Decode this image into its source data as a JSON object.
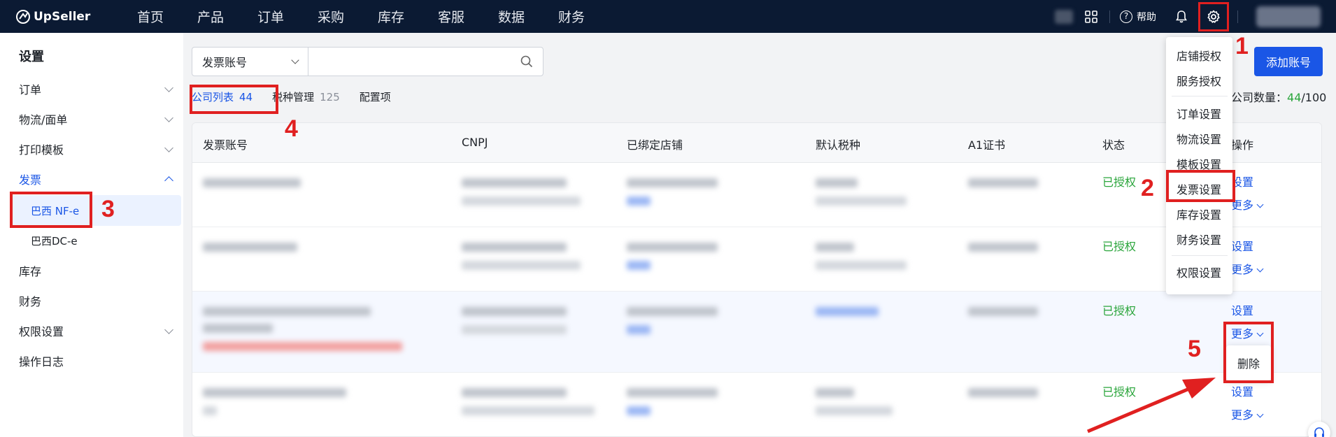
{
  "app": {
    "logo_text": "UpSeller"
  },
  "topnav": {
    "items": [
      "首页",
      "产品",
      "订单",
      "采购",
      "库存",
      "客服",
      "数据",
      "财务"
    ],
    "help_label": "帮助",
    "icons": [
      "apps-grid-icon",
      "help-icon",
      "bell-icon",
      "gear-icon"
    ]
  },
  "sidebar": {
    "title": "设置",
    "items": [
      {
        "label": "订单",
        "expandable": true
      },
      {
        "label": "物流/面单",
        "expandable": true
      },
      {
        "label": "打印模板",
        "expandable": true
      },
      {
        "label": "发票",
        "expandable": true,
        "expanded": true
      },
      {
        "label": "巴西 NF-e",
        "sub": true,
        "active": true
      },
      {
        "label": "巴西DC-e",
        "sub": true
      },
      {
        "label": "库存",
        "expandable": false
      },
      {
        "label": "财务",
        "expandable": false
      },
      {
        "label": "权限设置",
        "expandable": true
      },
      {
        "label": "操作日志",
        "expandable": false
      }
    ]
  },
  "search": {
    "select_value": "发票账号",
    "input_value": "",
    "input_placeholder": ""
  },
  "tabs": [
    {
      "label": "公司列表",
      "count": "44",
      "active": true
    },
    {
      "label": "税种管理",
      "count": "125"
    },
    {
      "label": "配置项",
      "count": ""
    }
  ],
  "actions": {
    "add_account": "添加账号",
    "company_count_label": "公司数量：",
    "company_count_used": "44",
    "company_count_total": "/100"
  },
  "table": {
    "headers": [
      "发票账号",
      "CNPJ",
      "已绑定店铺",
      "默认税种",
      "A1证书",
      "状态",
      "操作"
    ],
    "rows": [
      {
        "status": "已授权",
        "op_set": "设置",
        "op_more": "更多"
      },
      {
        "status": "已授权",
        "op_set": "设置",
        "op_more": "更多"
      },
      {
        "status": "已授权",
        "op_set": "设置",
        "op_more": "更多"
      },
      {
        "status": "已授权",
        "op_set": "设置",
        "op_more": "更多"
      }
    ]
  },
  "settings_menu": {
    "items": [
      "店铺授权",
      "服务授权",
      "订单设置",
      "物流设置",
      "模板设置",
      "发票设置",
      "库存设置",
      "财务设置",
      "权限设置"
    ]
  },
  "popover": {
    "delete_label": "删除"
  },
  "annotations": {
    "numbers": [
      "1",
      "2",
      "3",
      "4",
      "5"
    ],
    "color": "#e02020"
  },
  "colors": {
    "primary": "#1a56e6",
    "topbar": "#0b1a33",
    "success": "#2aa53b"
  }
}
